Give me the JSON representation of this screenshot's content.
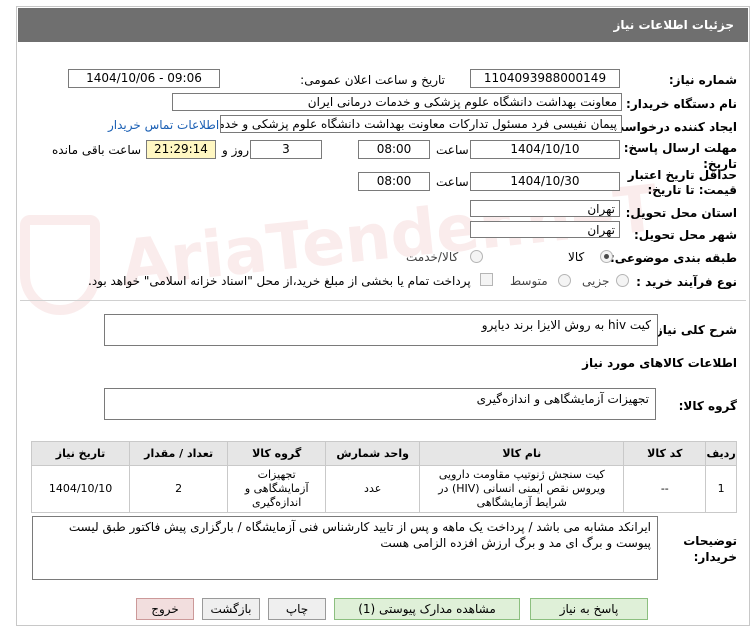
{
  "header": {
    "title": "جزئیات اطلاعات نیاز"
  },
  "form": {
    "need_number_label": "شماره نیاز:",
    "need_number": "1104093988000149",
    "announce_label": "تاریخ و ساعت اعلان عمومی:",
    "announce_value": "1404/10/06 - 09:06",
    "buyer_org_label": "نام دستگاه خریدار:",
    "buyer_org": "معاونت بهداشت دانشگاه علوم پزشکی و خدمات درمانی ایران",
    "creator_label": "ایجاد کننده درخواست:",
    "creator": "پیمان نفیسی فرد مسئول تدارکات  معاونت بهداشت دانشگاه علوم پزشکی و خدمات درمانی ایران",
    "contact_link": "اطلاعات تماس خریدار",
    "reply_deadline_label_1": "مهلت ارسال پاسخ: تا",
    "reply_deadline_label_2": "تاریخ:",
    "reply_date": "1404/10/10",
    "time_label": "ساعت",
    "reply_time": "08:00",
    "days_value": "3",
    "days_label": "روز و",
    "remaining_time": "21:29:14",
    "remaining_label": "ساعت باقی مانده",
    "price_validity_label_1": "حداقل تاریخ اعتبار",
    "price_validity_label_2": "قیمت: تا تاریخ:",
    "validity_date": "1404/10/30",
    "validity_time": "08:00",
    "province_label": "استان محل تحویل:",
    "province": "تهران",
    "city_label": "شهر محل تحویل:",
    "city": "تهران",
    "category_label": "طبقه بندی موضوعی:",
    "category_goods": "کالا",
    "category_goods_service": "کالا/خدمت",
    "purchase_type_label": "نوع فرآیند خرید :",
    "purchase_minor": "جزیی",
    "purchase_medium": "متوسط",
    "payment_note": "پرداخت تمام یا بخشی از مبلغ خرید،از محل \"اسناد خزانه اسلامی\" خواهد بود."
  },
  "need_summary": {
    "label": "شرح کلی نیاز:",
    "value": "کیت hiv به روش الایزا برند دیاپرو"
  },
  "goods_info": {
    "title": "اطلاعات کالاهای مورد نیاز",
    "group_label": "گروه کالا:",
    "group_value": "تجهیزات آزمایشگاهی و اندازه‌گیری"
  },
  "table": {
    "headers": [
      "ردیف",
      "کد کالا",
      "نام کالا",
      "واحد شمارش",
      "گروه کالا",
      "تعداد / مقدار",
      "تاریخ نیاز"
    ],
    "rows": [
      {
        "index": "1",
        "code": "--",
        "name": "کیت سنجش ژنوتیپ مقاومت دارویی ویروس نقص ایمنی انسانی (HIV) در شرایط آزمایشگاهی",
        "unit": "عدد",
        "group": "تجهیزات آزمایشگاهی و اندازه‌گیری",
        "quantity": "2",
        "date": "1404/10/10"
      }
    ]
  },
  "buyer_notes": {
    "label_1": "توضیحات",
    "label_2": "خریدار:",
    "value": "ایرانکد مشابه می باشد / پرداخت یک ماهه و پس از تایید کارشناس فنی آزمایشگاه / بارگزاری پیش فاکتور طبق لیست پیوست  و برگ ای مد و برگ ارزش افزده الزامی هست"
  },
  "buttons": {
    "reply": "پاسخ به نیاز",
    "attachments": "مشاهده مدارک پیوستی (1)",
    "print": "چاپ",
    "back": "بازگشت",
    "exit": "خروج"
  },
  "watermark": {
    "text": "AriaTender.neT"
  },
  "colors": {
    "header_bg": "#6f6f6f",
    "link": "#1a5fb4",
    "timer_bg": "#fff7c2"
  }
}
